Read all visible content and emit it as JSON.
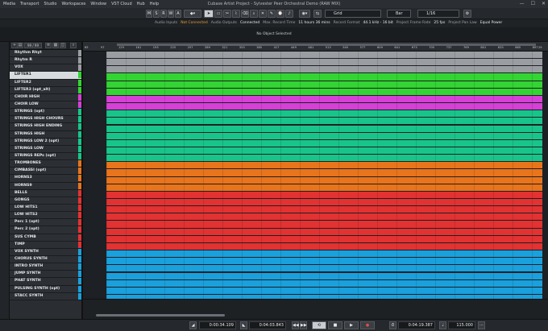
{
  "menu": [
    "Media",
    "Transport",
    "Studio",
    "Workspaces",
    "Window",
    "VST Cloud",
    "Hub",
    "Help"
  ],
  "window_title": "Cubase Artist Project - Sylvester Peer Orchestral Demo (RAW MIX)",
  "window_buttons": {
    "minimize": "—",
    "maximize": "☐",
    "close": "✕"
  },
  "toolbar": {
    "modes": [
      "M",
      "S",
      "R",
      "W",
      "A"
    ],
    "snap_label": "Grid",
    "grid_type": "Bar",
    "quantize": "1/16"
  },
  "status": [
    {
      "label": "Audio Inputs",
      "value": "Not Connected",
      "warn": true
    },
    {
      "label": "Audio Outputs",
      "value": "Connected",
      "warn": false
    },
    {
      "label": "Max. Record Time",
      "value": "11 hours 36 mins",
      "warn": false
    },
    {
      "label": "Record Format",
      "value": "44.1 kHz - 16 bit",
      "warn": false
    },
    {
      "label": "Project Frame Rate",
      "value": "25 fps",
      "warn": false
    },
    {
      "label": "Project Pan Law",
      "value": "Equal Power",
      "warn": false
    }
  ],
  "info_line": "No Object Selected",
  "tracklist": {
    "count": "99 / 99"
  },
  "tracks": [
    {
      "name": "Rhythm Rhyt",
      "color": "#9a9ea3"
    },
    {
      "name": "Rhytm R",
      "color": "#9a9ea3"
    },
    {
      "name": "VOX",
      "color": "#9a9ea3"
    },
    {
      "name": "LIFTER1",
      "color": "#33d433",
      "selected": true
    },
    {
      "name": "LIFTER2",
      "color": "#33d433"
    },
    {
      "name": "LIFTER3 (opt_alt)",
      "color": "#33d433"
    },
    {
      "name": "CHOIR HIGH",
      "color": "#d640d6"
    },
    {
      "name": "CHOIR LOW",
      "color": "#d640d6"
    },
    {
      "name": "STRINGS (opt)",
      "color": "#19c48a"
    },
    {
      "name": "STRINGS HIGH CHOURS",
      "color": "#19c48a"
    },
    {
      "name": "STRINGS HIGH ENDING",
      "color": "#19c48a"
    },
    {
      "name": "STRINGS HIGH",
      "color": "#19c48a"
    },
    {
      "name": "STRINGS LOW 2 (opt)",
      "color": "#19c48a"
    },
    {
      "name": "STRINGS LOW",
      "color": "#19c48a"
    },
    {
      "name": "STRINGS REPs (opt)",
      "color": "#19c48a"
    },
    {
      "name": "TROMBONES",
      "color": "#e8741c"
    },
    {
      "name": "CIMBASSI (opt)",
      "color": "#e8741c"
    },
    {
      "name": "HORNS3",
      "color": "#e8741c"
    },
    {
      "name": "HORNS9",
      "color": "#e8741c"
    },
    {
      "name": "BELLS",
      "color": "#e23232"
    },
    {
      "name": "GONGS",
      "color": "#e23232"
    },
    {
      "name": "LOW HITS1",
      "color": "#e23232"
    },
    {
      "name": "LOW HITS2",
      "color": "#e23232"
    },
    {
      "name": "Perc 1 (opt)",
      "color": "#e23232"
    },
    {
      "name": "Perc 2 (opt)",
      "color": "#e23232"
    },
    {
      "name": "SUS CYMB",
      "color": "#e23232"
    },
    {
      "name": "TIMP",
      "color": "#e23232"
    },
    {
      "name": "VOX SYNTH",
      "color": "#1aa0dc"
    },
    {
      "name": "CHORUS SYNTH",
      "color": "#1aa0dc"
    },
    {
      "name": "INTRO SYNTH",
      "color": "#1aa0dc"
    },
    {
      "name": "JUMP SYNTH",
      "color": "#1aa0dc"
    },
    {
      "name": "PHAT SYNTH",
      "color": "#1aa0dc"
    },
    {
      "name": "PULSING SYNTH (opt)",
      "color": "#1aa0dc"
    },
    {
      "name": "STACC SYNTH",
      "color": "#1aa0dc"
    }
  ],
  "ruler": {
    "left_markers": [
      "65",
      "97"
    ],
    "bars": [
      "129",
      "161",
      "193",
      "225",
      "257",
      "289",
      "321",
      "353",
      "385",
      "417",
      "449",
      "481",
      "513",
      "545",
      "577",
      "609",
      "641",
      "673",
      "705",
      "737",
      "769",
      "801",
      "833",
      "865",
      "897"
    ],
    "end": "29"
  },
  "transport": {
    "left_locator": "0:00:34.109",
    "right_locator": "0:04:03.843",
    "position": "0:04:19.387",
    "tempo": "115.000",
    "buttons": {
      "cycle": "⟲",
      "stop": "■",
      "play": "▶",
      "record": "●",
      "rewind": "◀◀",
      "forward": "▶▶"
    }
  }
}
